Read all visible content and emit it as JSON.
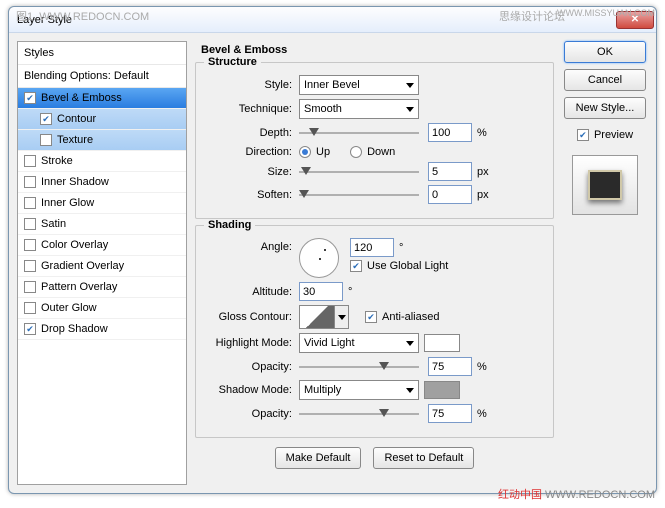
{
  "title": "Layer Style",
  "left": {
    "styles": "Styles",
    "blending": "Blending Options: Default",
    "items": [
      {
        "label": "Bevel & Emboss",
        "ck": true
      },
      {
        "label": "Contour",
        "ck": true
      },
      {
        "label": "Texture",
        "ck": false
      },
      {
        "label": "Stroke",
        "ck": false
      },
      {
        "label": "Inner Shadow",
        "ck": false
      },
      {
        "label": "Inner Glow",
        "ck": false
      },
      {
        "label": "Satin",
        "ck": false
      },
      {
        "label": "Color Overlay",
        "ck": false
      },
      {
        "label": "Gradient Overlay",
        "ck": false
      },
      {
        "label": "Pattern Overlay",
        "ck": false
      },
      {
        "label": "Outer Glow",
        "ck": false
      },
      {
        "label": "Drop Shadow",
        "ck": true
      }
    ]
  },
  "panel": {
    "title": "Bevel & Emboss",
    "structure": {
      "legend": "Structure",
      "style_lbl": "Style:",
      "style_val": "Inner Bevel",
      "tech_lbl": "Technique:",
      "tech_val": "Smooth",
      "depth_lbl": "Depth:",
      "depth_val": "100",
      "depth_unit": "%",
      "dir_lbl": "Direction:",
      "up": "Up",
      "down": "Down",
      "size_lbl": "Size:",
      "size_val": "5",
      "size_unit": "px",
      "soften_lbl": "Soften:",
      "soften_val": "0",
      "soften_unit": "px"
    },
    "shading": {
      "legend": "Shading",
      "angle_lbl": "Angle:",
      "angle_val": "120",
      "deg": "°",
      "global": "Use Global Light",
      "alt_lbl": "Altitude:",
      "alt_val": "30",
      "gloss_lbl": "Gloss Contour:",
      "aa": "Anti-aliased",
      "hl_lbl": "Highlight Mode:",
      "hl_val": "Vivid Light",
      "op_lbl": "Opacity:",
      "hl_op": "75",
      "sh_lbl": "Shadow Mode:",
      "sh_val": "Multiply",
      "sh_op": "75",
      "pct": "%"
    },
    "make_default": "Make Default",
    "reset": "Reset to Default"
  },
  "right": {
    "ok": "OK",
    "cancel": "Cancel",
    "new": "New Style...",
    "preview": "Preview"
  }
}
